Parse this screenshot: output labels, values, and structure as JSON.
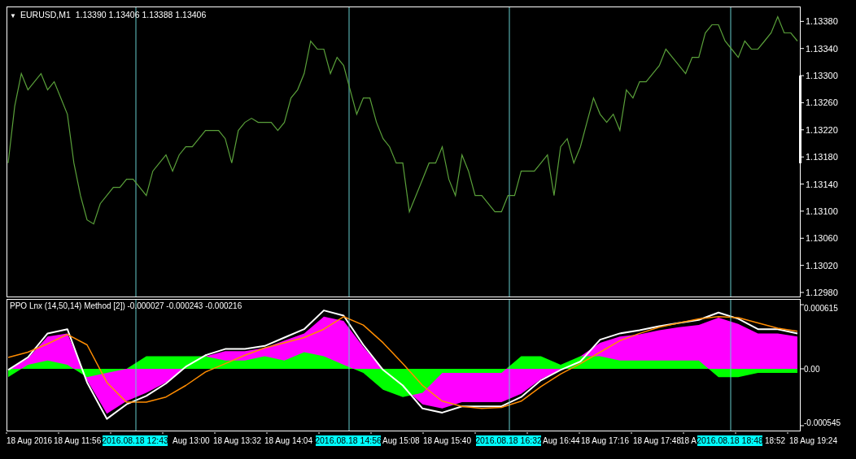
{
  "price_panel": {
    "menu_arrow": "▼",
    "title": "EURUSD,M1  1.13390 1.13406 1.13388 1.13406",
    "chart_data": {
      "type": "line",
      "ylim": [
        1.12974,
        1.13402
      ],
      "yticks": [
        {
          "value": 1.1338,
          "label": "1.13380"
        },
        {
          "value": 1.1334,
          "label": "1.13340"
        },
        {
          "value": 1.133,
          "label": "1.13300"
        },
        {
          "value": 1.1326,
          "label": "1.13260"
        },
        {
          "value": 1.1322,
          "label": "1.13220"
        },
        {
          "value": 1.1318,
          "label": "1.13180"
        },
        {
          "value": 1.1314,
          "label": "1.13140"
        },
        {
          "value": 1.131,
          "label": "1.13100"
        },
        {
          "value": 1.1306,
          "label": "1.13060"
        },
        {
          "value": 1.1302,
          "label": "1.13020"
        },
        {
          "value": 1.1298,
          "label": "1.12980"
        }
      ],
      "series": [
        {
          "color": "#5aa03a",
          "values": [
            1.13171,
            1.13255,
            1.13303,
            1.13279,
            1.13291,
            1.13303,
            1.13279,
            1.13291,
            1.13267,
            1.13243,
            1.13171,
            1.13123,
            1.13087,
            1.13081,
            1.13111,
            1.13123,
            1.13135,
            1.13135,
            1.13147,
            1.13147,
            1.13135,
            1.13123,
            1.13159,
            1.13171,
            1.13183,
            1.13159,
            1.13183,
            1.13195,
            1.13195,
            1.13207,
            1.13219,
            1.13219,
            1.13219,
            1.13207,
            1.13171,
            1.13219,
            1.13231,
            1.13237,
            1.13231,
            1.13231,
            1.13231,
            1.13219,
            1.13231,
            1.13267,
            1.13279,
            1.13303,
            1.13351,
            1.13339,
            1.13339,
            1.13303,
            1.13327,
            1.13315,
            1.13279,
            1.13243,
            1.13267,
            1.13267,
            1.13231,
            1.13207,
            1.13195,
            1.13171,
            1.13171,
            1.13099,
            1.13123,
            1.13147,
            1.13171,
            1.13171,
            1.13195,
            1.13147,
            1.13123,
            1.13183,
            1.13159,
            1.13123,
            1.13123,
            1.13111,
            1.13099,
            1.13099,
            1.13123,
            1.13123,
            1.13159,
            1.13159,
            1.13159,
            1.13171,
            1.13183,
            1.13123,
            1.13195,
            1.13207,
            1.13171,
            1.13195,
            1.13231,
            1.13267,
            1.13243,
            1.13231,
            1.13243,
            1.13219,
            1.13279,
            1.13267,
            1.13291,
            1.13291,
            1.13303,
            1.13315,
            1.13339,
            1.13327,
            1.13315,
            1.13303,
            1.13327,
            1.13327,
            1.13363,
            1.13375,
            1.13375,
            1.13351,
            1.13339,
            1.13327,
            1.13351,
            1.13339,
            1.13339,
            1.13351,
            1.13363,
            1.13387,
            1.13363,
            1.13363,
            1.13351
          ]
        }
      ]
    }
  },
  "indicator_panel": {
    "title": "PPO Lnx (14,50,14) Method [2]) -0.000027 -0.000243 -0.000216",
    "chart_data": {
      "type": "area",
      "ylim": [
        -0.000592,
        0.00067
      ],
      "yticks": [
        {
          "value": 0.000615,
          "label": "0.000615"
        },
        {
          "value": 0,
          "label": "0.00"
        },
        {
          "value": -0.000545,
          "label": "-0.000545"
        }
      ],
      "series": [
        {
          "type": "area",
          "color": "#ff00ff",
          "values": [
            -1e-05,
            0.0001,
            0.00031,
            0.00034,
            -0.00011,
            -0.00043,
            -0.00031,
            -0.00023,
            -0.00013,
            2e-05,
            0.00012,
            0.00017,
            0.00017,
            0.0002,
            0.00027,
            0.00034,
            0.0005,
            0.00046,
            0.00021,
            -1e-05,
            null,
            -0.00034,
            -0.00038,
            -0.00032,
            -0.00032,
            -0.00032,
            -0.00024,
            -0.0001,
            -1e-05,
            null,
            0.00025,
            0.00031,
            0.00033,
            0.00037,
            0.0004,
            0.00042,
            0.00049,
            0.00043,
            0.00034,
            0.00034,
            0.00031
          ]
        },
        {
          "type": "area",
          "color": "#00ff00",
          "values": [
            -8e-05,
            4e-05,
            8e-05,
            4e-05,
            -8e-05,
            -4e-05,
            0,
            0.00012,
            0.00012,
            0.00012,
            0.00012,
            8e-05,
            8e-05,
            0.00012,
            8e-05,
            0.00016,
            0.00012,
            4e-05,
            -4e-05,
            -0.0002,
            -0.00027,
            -0.00023,
            -4e-05,
            -4e-05,
            -4e-05,
            -4e-05,
            0.00012,
            0.00012,
            4e-05,
            0.00012,
            0.00012,
            8e-05,
            8e-05,
            8e-05,
            8e-05,
            8e-05,
            -8e-05,
            -8e-05,
            -4e-05,
            -4e-05,
            -4e-05
          ]
        },
        {
          "type": "line",
          "color": "#ffffff",
          "values": [
            -1e-05,
            0.00011,
            0.00034,
            0.00038,
            -0.00013,
            -0.00048,
            -0.00034,
            -0.00026,
            -0.00014,
            2e-05,
            0.00013,
            0.00019,
            0.00019,
            0.00022,
            0.0003,
            0.00038,
            0.00056,
            0.00051,
            0.00023,
            -1e-05,
            -0.00016,
            -0.00038,
            -0.00042,
            -0.00036,
            -0.00036,
            -0.00036,
            -0.00027,
            -0.00011,
            -1e-05,
            7e-05,
            0.00028,
            0.00034,
            0.00037,
            0.00041,
            0.00044,
            0.00047,
            0.00054,
            0.00048,
            0.00038,
            0.00038,
            0.00034
          ]
        },
        {
          "type": "line",
          "color": "#ff8c00",
          "values": [
            0.00011,
            0.00016,
            0.00024,
            0.00033,
            0.00023,
            -0.00013,
            -0.00032,
            -0.00032,
            -0.00027,
            -0.00016,
            -3e-05,
            5e-05,
            0.00013,
            0.0002,
            0.00025,
            0.0003,
            0.00038,
            0.0005,
            0.00042,
            0.00025,
            5e-05,
            -0.00016,
            -0.00031,
            -0.00036,
            -0.00038,
            -0.00037,
            -0.00031,
            -0.00017,
            -5e-05,
            5e-05,
            0.00016,
            0.00027,
            0.00034,
            0.0004,
            0.00044,
            0.00048,
            0.0005,
            0.00049,
            0.00044,
            0.00039,
            0.00036
          ]
        }
      ]
    }
  },
  "time_axis": {
    "labels": [
      {
        "text": "18 Aug 2016",
        "kind": "tick"
      },
      {
        "text": "18 Aug 11:56",
        "kind": "tick"
      },
      {
        "text": "2016.08.18 12:43",
        "kind": "cursor"
      },
      {
        "text": "Aug 13:00",
        "kind": "tick"
      },
      {
        "text": "18 Aug 13:32",
        "kind": "tick"
      },
      {
        "text": "18 Aug 14:04",
        "kind": "tick"
      },
      {
        "text": "2016.08.18 14:56",
        "kind": "cursor"
      },
      {
        "text": "Aug 15:08",
        "kind": "tick"
      },
      {
        "text": "18 Aug 15:40",
        "kind": "tick"
      },
      {
        "text": "2016.08.18 16:32",
        "kind": "cursor"
      },
      {
        "text": "Aug 16:44",
        "kind": "tick"
      },
      {
        "text": "18 Aug 17:16",
        "kind": "tick"
      },
      {
        "text": "18 Aug 17:48",
        "kind": "tick"
      },
      {
        "text": "18 A",
        "kind": "tick"
      },
      {
        "text": "2016.08.18 18:48",
        "kind": "cursor"
      },
      {
        "text": "18:52",
        "kind": "tick"
      },
      {
        "text": "18 Aug 19:24",
        "kind": "tick"
      }
    ]
  }
}
